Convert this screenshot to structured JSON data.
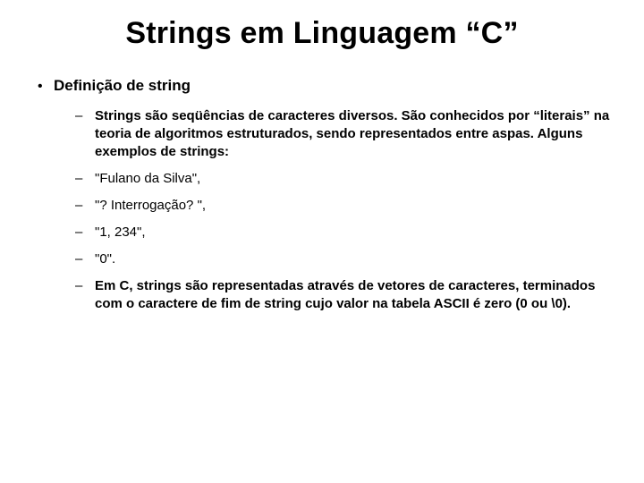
{
  "title": "Strings em Linguagem “C”",
  "bullet_level1": {
    "marker": "•",
    "text": "Definição de string"
  },
  "bullet_level2": {
    "marker": "–",
    "items": [
      "Strings são seqüências de caracteres diversos. São conhecidos por “literais” na teoria de algoritmos estruturados, sendo representados entre aspas. Alguns exemplos de strings:",
      "\"Fulano da Silva\",",
      "\"? Interrogação? \",",
      "\"1, 234\",",
      "\"0\".",
      "Em C, strings são representadas através de vetores de caracteres, terminados com o caractere de fim de string cujo valor na tabela ASCII é zero (0 ou \\0)."
    ]
  }
}
